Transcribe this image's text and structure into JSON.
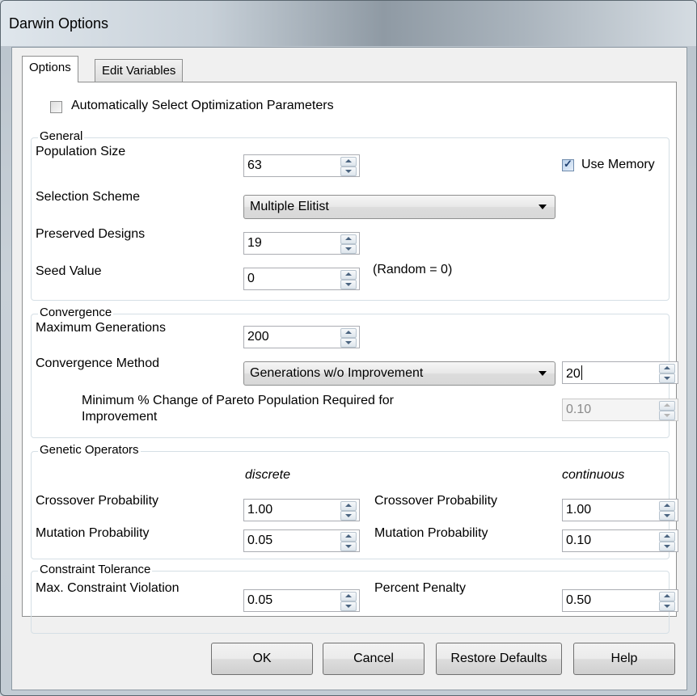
{
  "window": {
    "title": "Darwin Options"
  },
  "tabs": [
    {
      "label": "Options",
      "active": true
    },
    {
      "label": "Edit Variables",
      "active": false
    }
  ],
  "auto_select": {
    "label": "Automatically Select Optimization Parameters",
    "checked": false
  },
  "general": {
    "title": "General",
    "population_size": {
      "label": "Population Size",
      "value": "63"
    },
    "use_memory": {
      "label": "Use Memory",
      "checked": true
    },
    "selection_scheme": {
      "label": "Selection Scheme",
      "value": "Multiple Elitist"
    },
    "preserved_designs": {
      "label": "Preserved Designs",
      "value": "19"
    },
    "seed_value": {
      "label": "Seed Value",
      "value": "0",
      "hint": "(Random = 0)"
    }
  },
  "convergence": {
    "title": "Convergence",
    "max_generations": {
      "label": "Maximum Generations",
      "value": "200"
    },
    "method": {
      "label": "Convergence Method",
      "value": "Generations w/o Improvement",
      "count": "20"
    },
    "min_change": {
      "label_line1": "Minimum % Change of Pareto Population Required for",
      "label_line2": "Improvement",
      "value": "0.10"
    }
  },
  "genetic": {
    "title": "Genetic Operators",
    "discrete_header": "discrete",
    "continuous_header": "continuous",
    "discrete_crossover": {
      "label": "Crossover Probability",
      "value": "1.00"
    },
    "discrete_mutation": {
      "label": "Mutation Probability",
      "value": "0.05"
    },
    "continuous_crossover": {
      "label": "Crossover Probability",
      "value": "1.00"
    },
    "continuous_mutation": {
      "label": "Mutation Probability",
      "value": "0.10"
    }
  },
  "constraint": {
    "title": "Constraint Tolerance",
    "max_violation": {
      "label": "Max. Constraint Violation",
      "value": "0.05"
    },
    "percent_penalty": {
      "label": "Percent Penalty",
      "value": "0.50"
    }
  },
  "buttons": {
    "ok": "OK",
    "cancel": "Cancel",
    "restore": "Restore Defaults",
    "help": "Help"
  },
  "colors": {
    "panel_bg": "#ffffff",
    "dialog_bg": "#f0f0f0",
    "group_border": "#d5dfe5",
    "arrow": "#4b6480"
  }
}
